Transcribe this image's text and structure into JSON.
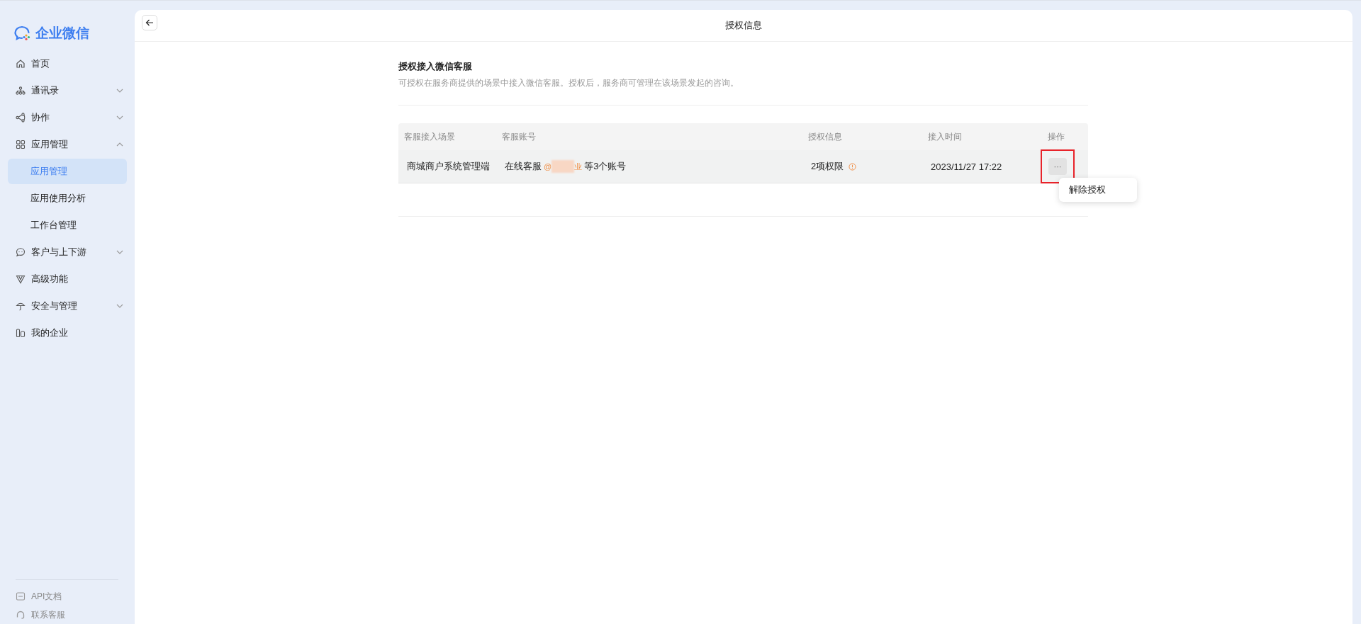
{
  "sidebar": {
    "logo": "企业微信",
    "items": [
      {
        "label": "首页"
      },
      {
        "label": "通讯录",
        "expanded": false
      },
      {
        "label": "协作",
        "expanded": false
      },
      {
        "label": "应用管理",
        "expanded": true,
        "children": [
          {
            "label": "应用管理",
            "selected": true
          },
          {
            "label": "应用使用分析",
            "selected": false
          },
          {
            "label": "工作台管理",
            "selected": false
          }
        ]
      },
      {
        "label": "客户与上下游",
        "expanded": false
      },
      {
        "label": "高级功能"
      },
      {
        "label": "安全与管理",
        "expanded": false
      },
      {
        "label": "我的企业"
      }
    ],
    "footer": [
      {
        "label": "API文档"
      },
      {
        "label": "联系客服"
      }
    ]
  },
  "header": {
    "title": "授权信息"
  },
  "section": {
    "title": "授权接入微信客服",
    "description": "可授权在服务商提供的场景中接入微信客服。授权后，服务商可管理在该场景发起的咨询。"
  },
  "table": {
    "columns": [
      "客服接入场景",
      "客服账号",
      "授权信息",
      "接入时间",
      "操作"
    ],
    "rows": [
      {
        "scene": "商城商户系统管理端",
        "account": "在线客服",
        "account_tag_start": "@",
        "account_tag_end": "业",
        "account_more": "等3个账号",
        "permissions": "2项权限",
        "warning": true,
        "time": "2023/11/27 17:22",
        "action": "···",
        "highlighted": true
      }
    ]
  },
  "menu": {
    "items": [
      "解除授权"
    ]
  }
}
